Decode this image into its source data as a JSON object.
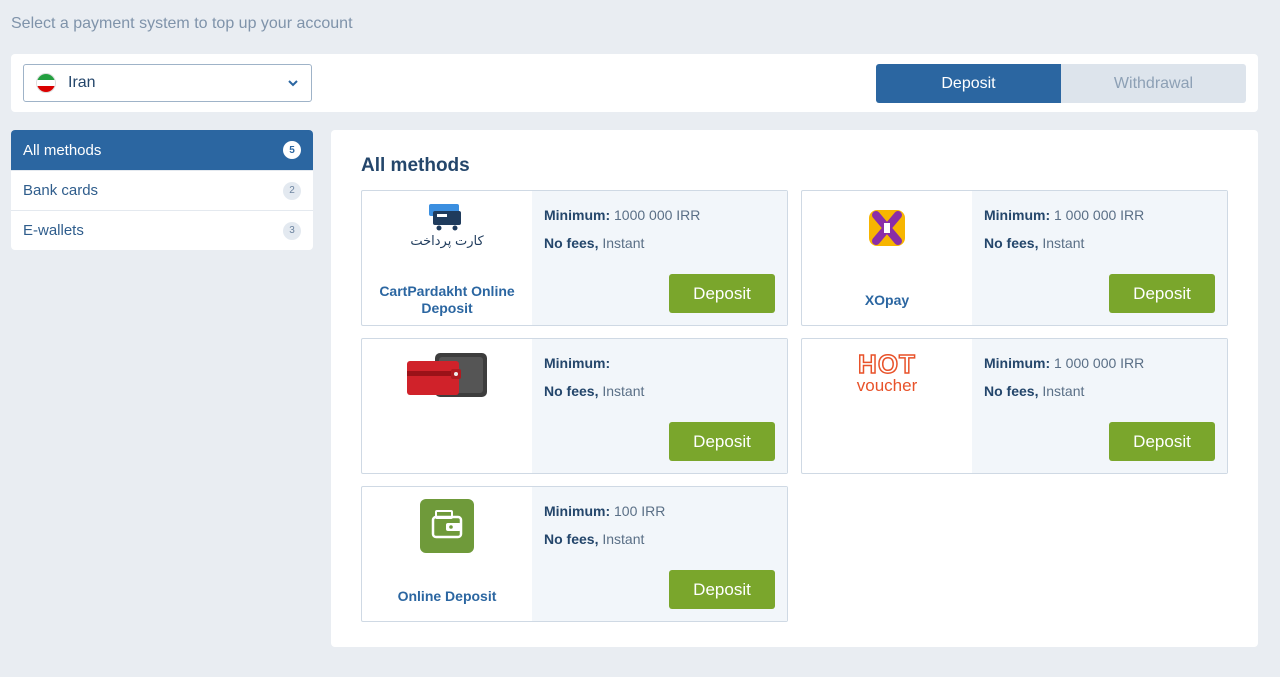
{
  "header": {
    "subtitle": "Select a payment system to top up your account"
  },
  "country": {
    "name": "Iran",
    "flag_colors": [
      "#239f40",
      "#ffffff",
      "#da0000"
    ]
  },
  "mode": {
    "deposit_label": "Deposit",
    "withdrawal_label": "Withdrawal",
    "active": "Deposit"
  },
  "sidebar": {
    "items": [
      {
        "label": "All methods",
        "count": "5",
        "active": true
      },
      {
        "label": "Bank cards",
        "count": "2",
        "active": false
      },
      {
        "label": "E-wallets",
        "count": "3",
        "active": false
      }
    ]
  },
  "main": {
    "title": "All methods",
    "cards": [
      {
        "name": "CartPardakht Online Deposit",
        "logo": "cartpardakht-logo",
        "logo_text": "کارت پرداخت",
        "minimum_label": "Minimum:",
        "minimum_value": " 1000 000 IRR",
        "fees_label": "No fees,",
        "speed": " Instant",
        "button": "Deposit"
      },
      {
        "name": "XOpay",
        "logo": "xopay-logo",
        "minimum_label": "Minimum:",
        "minimum_value": " 1 000 000 IRR",
        "fees_label": "No fees,",
        "speed": " Instant",
        "button": "Deposit"
      },
      {
        "name": "",
        "logo": "card-wallet-logo",
        "minimum_label": "Minimum:",
        "minimum_value": "",
        "fees_label": "No fees,",
        "speed": " Instant",
        "button": "Deposit"
      },
      {
        "name": "",
        "logo": "hot-voucher-logo",
        "logo_text_top": "HOT",
        "logo_text_bottom": "voucher",
        "minimum_label": "Minimum:",
        "minimum_value": " 1 000 000 IRR",
        "fees_label": "No fees,",
        "speed": " Instant",
        "button": "Deposit"
      },
      {
        "name": "Online Deposit",
        "logo": "online-deposit-logo",
        "minimum_label": "Minimum:",
        "minimum_value": " 100 IRR",
        "fees_label": "No fees,",
        "speed": " Instant",
        "button": "Deposit"
      }
    ]
  },
  "colors": {
    "primary": "#2b66a1",
    "deposit_button": "#7aa62c",
    "background": "#e9edf2"
  }
}
